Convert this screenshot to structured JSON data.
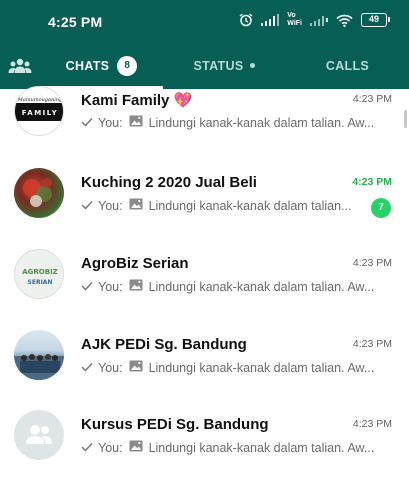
{
  "status_bar": {
    "time": "4:25 PM",
    "volte_top": "Vo",
    "volte_bottom": "WiFi",
    "battery": "49",
    "icons": [
      "alarm-icon",
      "signal-icon",
      "volte-wifi-icon",
      "signal-icon",
      "wifi-icon",
      "battery-icon"
    ]
  },
  "tabs": {
    "community_icon": "community-icon",
    "chats_label": "CHATS",
    "chats_badge": "8",
    "status_label": "STATUS",
    "calls_label": "CALLS"
  },
  "colors": {
    "header": "#075e54",
    "accent_green": "#25d366",
    "unread_time": "#25b04e"
  },
  "chats": [
    {
      "name": "Kami Family",
      "emoji": "💖",
      "time": "4:23 PM",
      "preview_prefix": "You:",
      "preview_text": "Lindungi kanak-kanak dalam talian. Aw...",
      "avatar_text": "Mamumouganing",
      "avatar_text2": "FAMILY",
      "unread": ""
    },
    {
      "name": "Kuching 2 2020 Jual Beli",
      "time": "4:23 PM",
      "preview_prefix": "You:",
      "preview_text": "Lindungi kanak-kanak dalam talian...",
      "unread": "7"
    },
    {
      "name": "AgroBiz Serian",
      "time": "4:23 PM",
      "preview_prefix": "You:",
      "preview_text": "Lindungi kanak-kanak dalam talian. Aw...",
      "avatar_text": "AGROBIZ",
      "avatar_text2": "SERIAN",
      "unread": ""
    },
    {
      "name": "AJK PEDi Sg. Bandung",
      "time": "4:23 PM",
      "preview_prefix": "You:",
      "preview_text": "Lindungi kanak-kanak dalam talian. Aw...",
      "unread": ""
    },
    {
      "name": "Kursus PEDi Sg. Bandung",
      "time": "4:23 PM",
      "preview_prefix": "You:",
      "preview_text": "Lindungi kanak-kanak dalam talian. Aw...",
      "unread": ""
    }
  ]
}
